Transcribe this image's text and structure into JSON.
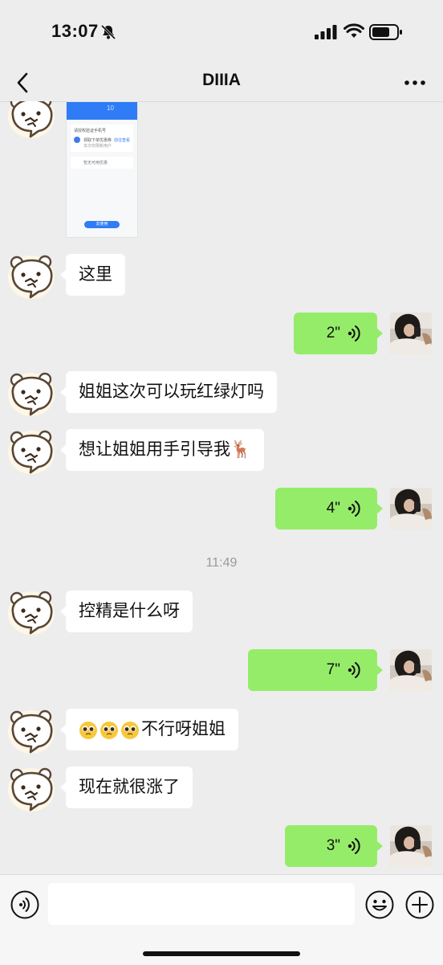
{
  "status_bar": {
    "time": "13:07"
  },
  "nav": {
    "title": "DIIIA"
  },
  "screenshot_preview": {
    "badge": "10",
    "lines": [
      "请授权验证手机号",
      "领取下单优惠券",
      "本次仅限新用户",
      "暂无可用优惠",
      "前往查看",
      "去使用"
    ]
  },
  "messages": [
    {
      "side": "in",
      "text": "这里"
    },
    {
      "side": "out",
      "type": "voice",
      "duration": "2\""
    },
    {
      "side": "in",
      "text": "姐姐这次可以玩红绿灯吗"
    },
    {
      "side": "in",
      "text": "想让姐姐用手引导我🦌"
    },
    {
      "side": "out",
      "type": "voice",
      "duration": "4\""
    },
    {
      "side": "in",
      "text": "控精是什么呀"
    },
    {
      "side": "out",
      "type": "voice",
      "duration": "7\""
    },
    {
      "side": "in",
      "emoji": [
        "pleading-face",
        "pleading-face",
        "pleading-face"
      ],
      "text": "不行呀姐姐"
    },
    {
      "side": "in",
      "text": "现在就很涨了"
    },
    {
      "side": "out",
      "type": "voice",
      "duration": "3\""
    }
  ],
  "time_divider": "11:49",
  "input": {
    "value": "",
    "placeholder": ""
  },
  "icons": {
    "back": "chevron-left-icon",
    "more": "more-icon",
    "voice_toggle": "voice-mode-icon",
    "emoji": "emoji-icon",
    "plus": "plus-icon",
    "voice_wave": "voice-wave-icon"
  },
  "colors": {
    "background": "#ededed",
    "incoming_bubble": "#ffffff",
    "outgoing_bubble": "#95ec69",
    "muted_text": "#9a9a9a"
  }
}
